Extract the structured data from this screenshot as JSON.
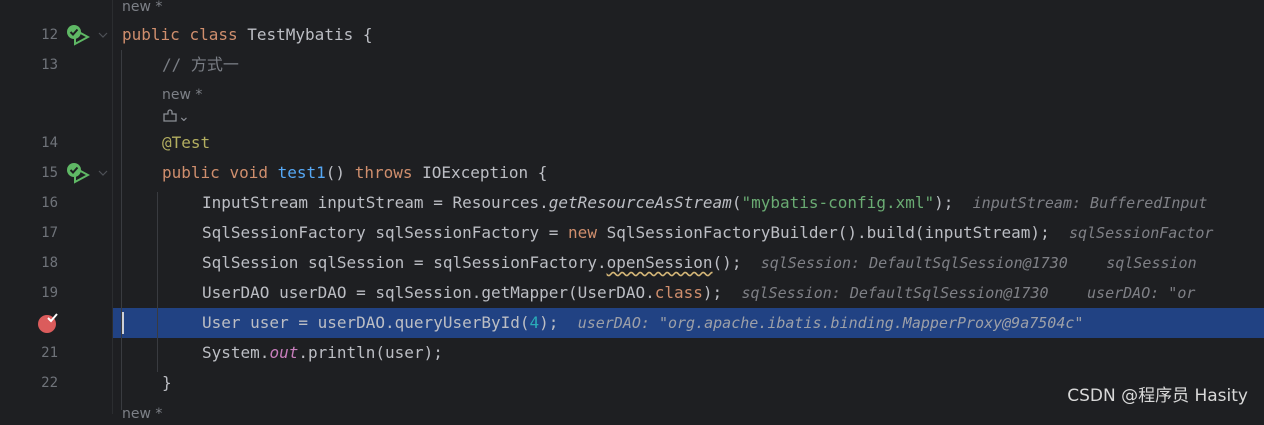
{
  "gutter": {
    "line_numbers": [
      "12",
      "13",
      "14",
      "15",
      "16",
      "17",
      "18",
      "19",
      "21",
      "22"
    ],
    "current_line": "20"
  },
  "hints": {
    "new_top": "new *",
    "new_method": "new *",
    "new_bottom": "new *",
    "icon_chevron": "⌄"
  },
  "code": {
    "l12": {
      "kw1": "public",
      "kw2": "class",
      "name": "TestMybatis",
      "brace": " {"
    },
    "l13": {
      "comment": "// 方式一"
    },
    "l14": {
      "annotation": "@Test"
    },
    "l15": {
      "kw1": "public",
      "kw2": "void",
      "name": "test1",
      "params": "()",
      "kw3": "throws",
      "rest": "IOException {"
    },
    "l16": {
      "a": "InputStream inputStream = Resources.",
      "call": "getResourceAsStream",
      "b": "(",
      "str": "\"mybatis-config.xml\"",
      "c": ");",
      "inline": "inputStream: BufferedInput"
    },
    "l17": {
      "a": "SqlSessionFactory sqlSessionFactory = ",
      "kw": "new",
      "b": " SqlSessionFactoryBuilder().build(inputStream);",
      "inline": "sqlSessionFactor"
    },
    "l18": {
      "a": "SqlSession sqlSession = sqlSessionFactory.",
      "call": "openSession",
      "b": "();",
      "inline1": "sqlSession: DefaultSqlSession@1730",
      "inline2": "sqlSession"
    },
    "l19": {
      "a": "UserDAO userDAO = sqlSession.getMapper(UserDAO.",
      "kw": "class",
      "b": ");",
      "inline1": "sqlSession: DefaultSqlSession@1730",
      "inline2": "userDAO: \"or"
    },
    "l20": {
      "a": "User user = userDAO.queryUserById(",
      "num": "4",
      "b": ");",
      "inline": "userDAO: \"org.apache.ibatis.binding.MapperProxy@9a7504c\""
    },
    "l21": {
      "a": "System.",
      "field": "out",
      "b": ".println(user);"
    },
    "l22": {
      "brace": "}"
    }
  },
  "watermark": "CSDN @程序员 Hasity",
  "colors": {
    "background": "#1e1f22",
    "execution_line": "#214283",
    "keyword": "#cf8e6d",
    "string": "#6aab73",
    "function": "#56a8f5",
    "number": "#2aacb8",
    "breakpoint": "#db5c5c",
    "run_icon": "#5fb865"
  }
}
